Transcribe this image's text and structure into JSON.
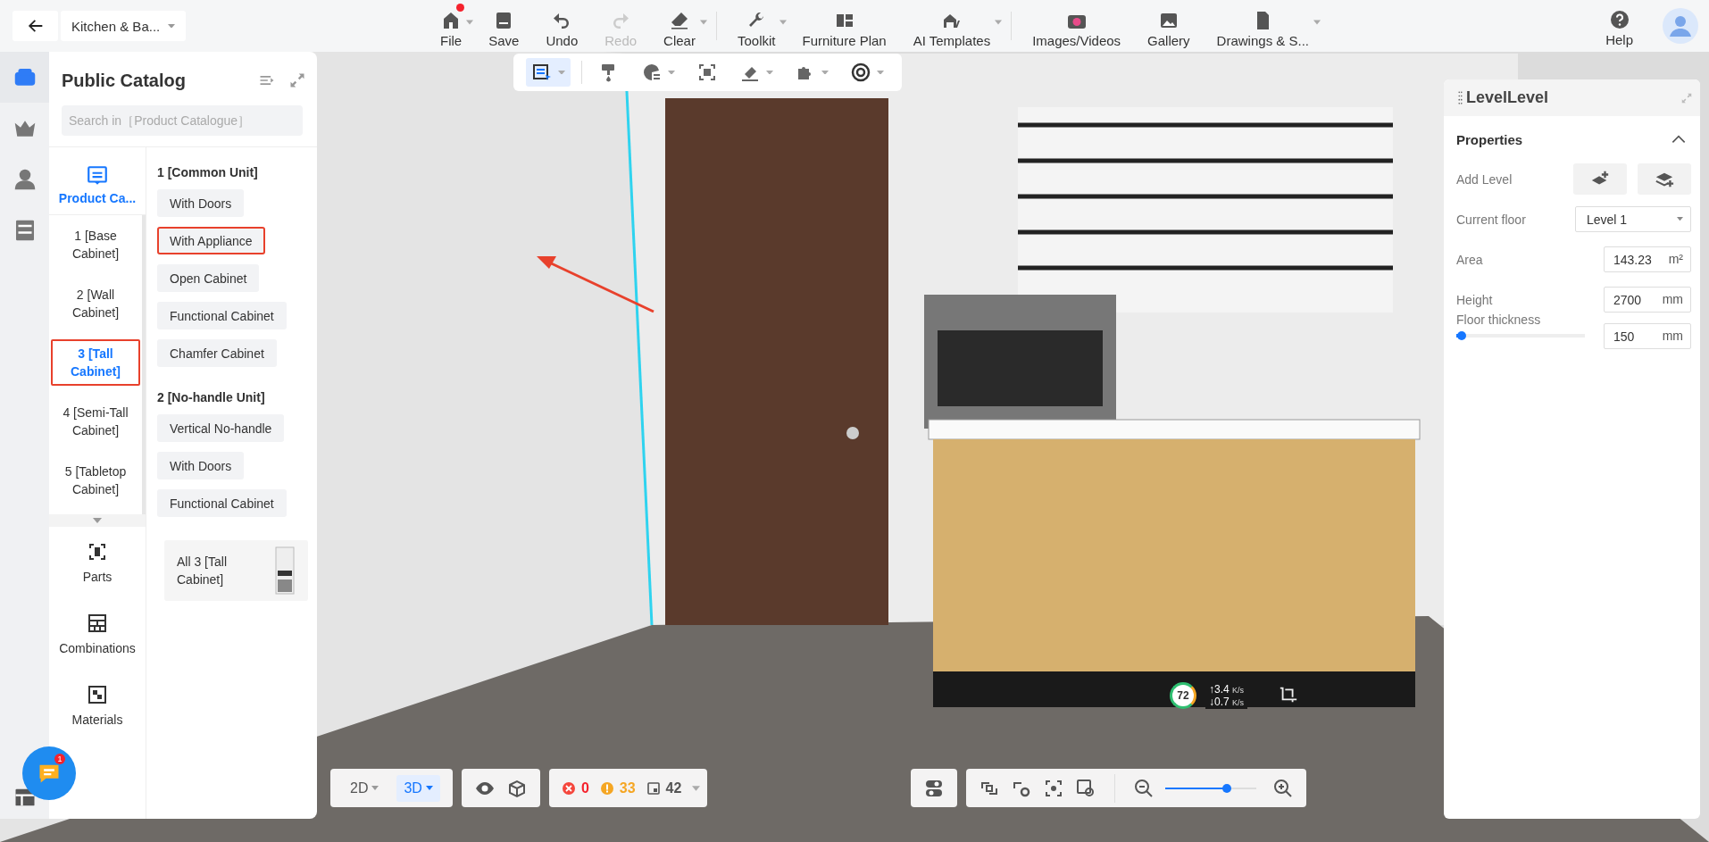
{
  "top_bar": {
    "project": "Kitchen & Ba...",
    "tool_groups": [
      [
        {
          "label": "File",
          "dropdown": true,
          "badge": true,
          "disabled": false
        },
        {
          "label": "Save",
          "dropdown": false,
          "badge": false,
          "disabled": false
        },
        {
          "label": "Undo",
          "dropdown": false,
          "badge": false,
          "disabled": false
        },
        {
          "label": "Redo",
          "dropdown": false,
          "badge": false,
          "disabled": true
        },
        {
          "label": "Clear",
          "dropdown": true,
          "badge": false,
          "disabled": false
        }
      ],
      [
        {
          "label": "Toolkit",
          "dropdown": true,
          "badge": false,
          "disabled": false
        },
        {
          "label": "Furniture Plan",
          "dropdown": false,
          "badge": false,
          "disabled": false
        },
        {
          "label": "AI Templates",
          "dropdown": true,
          "badge": false,
          "disabled": false
        }
      ],
      [
        {
          "label": "Images/Videos",
          "dropdown": false,
          "badge": false,
          "disabled": false
        },
        {
          "label": "Gallery",
          "dropdown": false,
          "badge": false,
          "disabled": false
        },
        {
          "label": "Drawings & S...",
          "dropdown": true,
          "badge": false,
          "disabled": false
        }
      ]
    ],
    "help": "Help"
  },
  "rail": [
    {
      "selected": true
    },
    {
      "selected": false
    },
    {
      "selected": false
    },
    {
      "selected": false
    }
  ],
  "view_toolbar": [
    {
      "selected": true,
      "dropdown": true
    },
    {
      "selected": false,
      "dropdown": false
    },
    {
      "selected": false,
      "dropdown": true
    },
    {
      "selected": false,
      "dropdown": false
    },
    {
      "selected": false,
      "dropdown": true
    },
    {
      "selected": false,
      "dropdown": true
    },
    {
      "selected": false,
      "dropdown": true
    }
  ],
  "catalog": {
    "title": "Public Catalog",
    "search": {
      "placeholder": "Search in［Product Catalogue］"
    },
    "main_tab": {
      "label": "Product Ca...",
      "selected": true
    },
    "categories": [
      {
        "label": "1 [Base Cabinet]",
        "selected": false,
        "highlighted": false
      },
      {
        "label": "2 [Wall Cabinet]",
        "selected": false,
        "highlighted": false
      },
      {
        "label": "3 [Tall Cabinet]",
        "selected": true,
        "highlighted": true
      },
      {
        "label": "4 [Semi-Tall Cabinet]",
        "selected": false,
        "highlighted": false
      },
      {
        "label": "5 [Tabletop Cabinet]",
        "selected": false,
        "highlighted": false
      }
    ],
    "other_tabs": [
      {
        "label": "Parts"
      },
      {
        "label": "Combinations"
      },
      {
        "label": "Materials"
      }
    ],
    "groups": [
      {
        "title": "1 [Common Unit]",
        "chips": [
          {
            "label": "With Doors",
            "highlighted": false
          },
          {
            "label": "With Appliance",
            "highlighted": true
          },
          {
            "label": "Open Cabinet",
            "highlighted": false
          },
          {
            "label": "Functional Cabinet",
            "highlighted": false
          },
          {
            "label": "Chamfer Cabinet",
            "highlighted": false
          }
        ]
      },
      {
        "title": "2 [No-handle Unit]",
        "chips": [
          {
            "label": "Vertical No-handle",
            "highlighted": false
          },
          {
            "label": "With Doors",
            "highlighted": false
          },
          {
            "label": "Functional Cabinet",
            "highlighted": false
          }
        ]
      }
    ],
    "all_card": "All 3 [Tall Cabinet]"
  },
  "properties": {
    "title": "LevelLevel",
    "section": "Properties",
    "expanded": true,
    "add_level": "Add Level",
    "current_floor": {
      "label": "Current floor",
      "value": "Level 1"
    },
    "area": {
      "label": "Area",
      "value": "143.23",
      "unit": "m²"
    },
    "height": {
      "label": "Height",
      "value": "2700",
      "unit": "mm"
    },
    "thickness": {
      "label": "Floor thickness",
      "value": "150",
      "unit": "mm",
      "level": 0
    }
  },
  "network": {
    "score": "72",
    "up": "↑3.4",
    "down": "↓0.7",
    "unit_up": "K/s",
    "unit_down": "K/s"
  },
  "bottom": {
    "modes": [
      {
        "label": "2D",
        "selected": false
      },
      {
        "label": "3D",
        "selected": true
      }
    ],
    "errors": "0",
    "warnings": "33",
    "objects": "42",
    "zoom": {
      "level": 0.65
    }
  },
  "chat": {
    "badge": "1"
  }
}
